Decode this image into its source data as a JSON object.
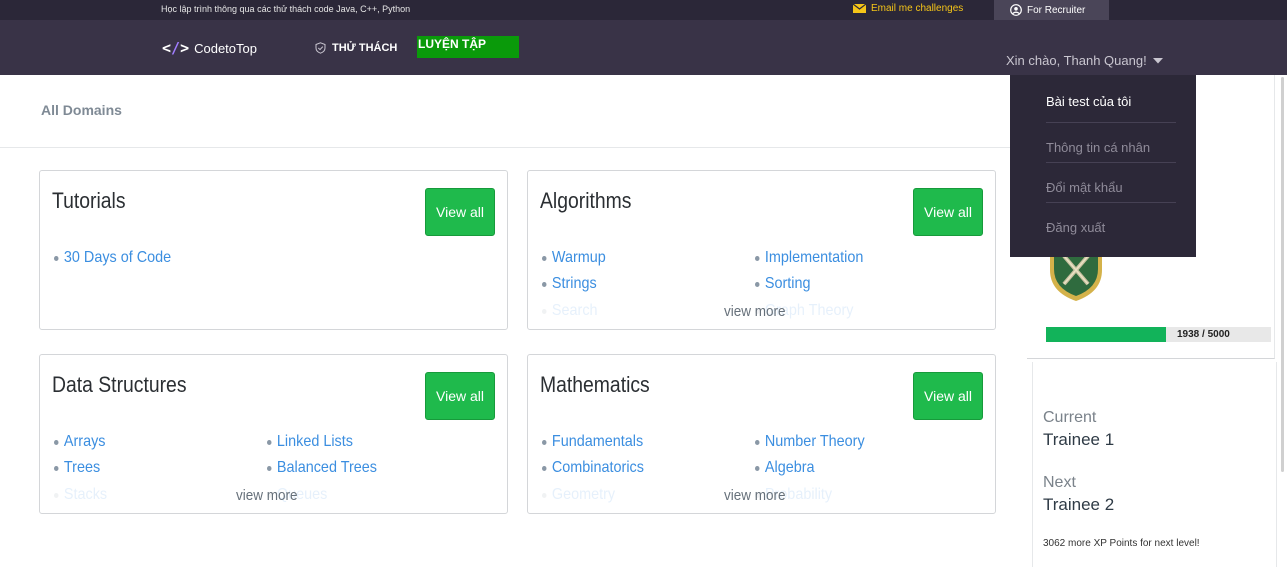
{
  "topbar": {
    "tagline": "Học lập trình thông qua các thử thách code Java, C++, Python",
    "email_label": "Email me challenges",
    "recruiter_label": "For Recruiter"
  },
  "nav": {
    "logo": "CodetoTop",
    "challenge": "THỬ THÁCH",
    "practice": "LUYỆN TẬP",
    "greeting": "Xin chào, Thanh Quang!"
  },
  "dropdown": {
    "items": [
      "Bài test của tôi",
      "Thông tin cá nhân",
      "Đổi mật khẩu",
      "Đăng xuất"
    ]
  },
  "breadcrumb": "All Domains",
  "cards": [
    {
      "title": "Tutorials",
      "view_all": "View all",
      "topics": [
        "30 Days of Code"
      ]
    },
    {
      "title": "Algorithms",
      "view_all": "View all",
      "topics": [
        "Warmup",
        "Implementation",
        "Strings",
        "Sorting",
        "Search",
        "Graph Theory"
      ],
      "more": "view more"
    },
    {
      "title": "Data Structures",
      "view_all": "View all",
      "topics": [
        "Arrays",
        "Linked Lists",
        "Trees",
        "Balanced Trees",
        "Stacks",
        "Queues"
      ],
      "more": "view more"
    },
    {
      "title": "Mathematics",
      "view_all": "View all",
      "topics": [
        "Fundamentals",
        "Number Theory",
        "Combinatorics",
        "Algebra",
        "Geometry",
        "Probability"
      ],
      "more": "view more"
    }
  ],
  "profile": {
    "xp_text": "1938 / 5000",
    "xp_fraction": 0.532,
    "current_label": "Current",
    "current_level": "Trainee 1",
    "next_label": "Next",
    "next_level": "Trainee 2",
    "note": "3062 more XP Points for next level!"
  },
  "colors": {
    "accent_green": "#1fba4c",
    "link_blue": "#3b8ee0",
    "nav_bg": "#393347"
  }
}
